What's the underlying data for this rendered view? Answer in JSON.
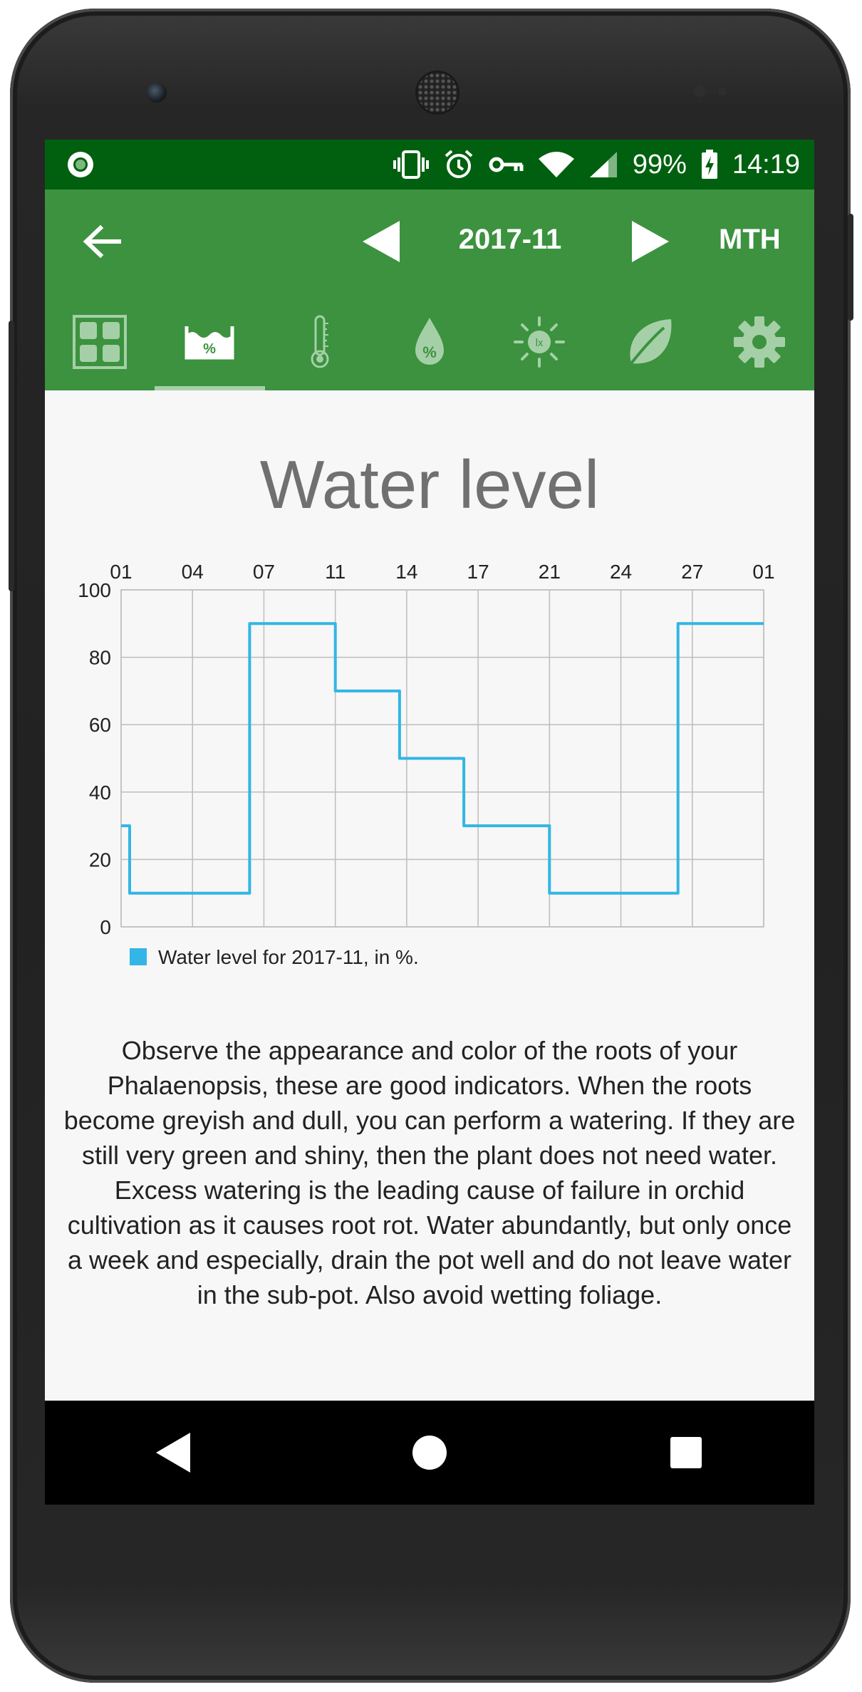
{
  "status_bar": {
    "battery": "99%",
    "time": "14:19"
  },
  "toolbar": {
    "period": "2017-11",
    "mode": "MTH"
  },
  "tabs": [
    {
      "name": "dashboard",
      "active": false
    },
    {
      "name": "water-level",
      "active": true
    },
    {
      "name": "temperature",
      "active": false
    },
    {
      "name": "humidity",
      "active": false
    },
    {
      "name": "light",
      "active": false
    },
    {
      "name": "plant",
      "active": false
    },
    {
      "name": "settings",
      "active": false
    }
  ],
  "chart_data": {
    "type": "line",
    "title": "Water level",
    "x_tick_labels": [
      "01",
      "04",
      "07",
      "11",
      "14",
      "17",
      "21",
      "24",
      "27",
      "01"
    ],
    "x": [
      1,
      1.4,
      1.4,
      7,
      7,
      11,
      11,
      14,
      14,
      17,
      17,
      21,
      21,
      24,
      24,
      27,
      27,
      31
    ],
    "series": [
      {
        "name": "Water level for 2017-11, in %.",
        "color": "#33b5e5",
        "values": [
          30,
          30,
          10,
          10,
          90,
          90,
          70,
          70,
          50,
          50,
          30,
          30,
          10,
          10,
          10,
          10,
          90,
          90
        ]
      }
    ],
    "ylim": [
      0,
      100
    ],
    "y_ticks": [
      "0",
      "20",
      "40",
      "60",
      "80",
      "100"
    ],
    "grid": true,
    "legend": "bottom-left"
  },
  "tip_text": "Observe the appearance and color of the roots of your Phalaenopsis, these are good indicators. When the roots become greyish and dull, you can perform a watering. If they are still very green and shiny, then the plant does not need water. Excess watering is the leading cause of failure in orchid cultivation as it causes root rot. Water abundantly, but only once a week and especially, drain the pot well and do not leave water in the sub-pot. Also avoid wetting foliage."
}
